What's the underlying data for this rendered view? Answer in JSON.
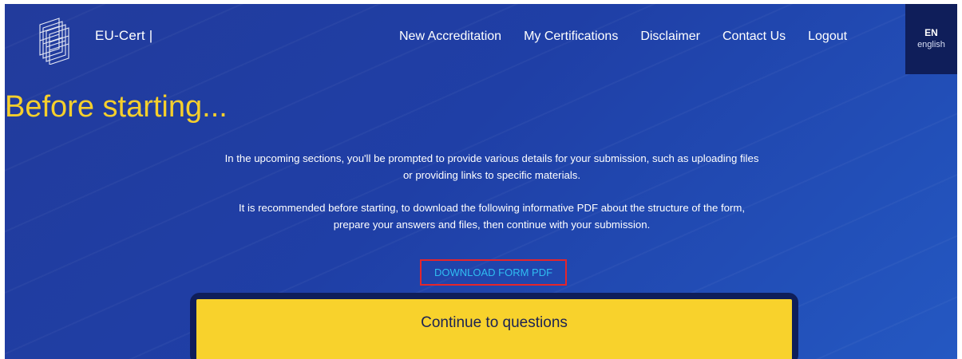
{
  "header": {
    "brand": "EU-Cert |",
    "logo_icon": "eu-cert-logo-icon",
    "nav": [
      {
        "label": "New Accreditation"
      },
      {
        "label": "My Certifications"
      },
      {
        "label": "Disclaimer"
      },
      {
        "label": "Contact Us"
      },
      {
        "label": "Logout"
      }
    ],
    "language": {
      "code": "EN",
      "name": "english"
    }
  },
  "main": {
    "title": "Before starting...",
    "intro_1_line_1": "In the upcoming sections, you'll be prompted to provide various details for your submission, such as uploading files",
    "intro_1_line_2": "or providing links to specific materials.",
    "intro_2_line_1": "It is recommended before starting, to download the following informative PDF about the structure of the form,",
    "intro_2_line_2": "prepare your answers and files, then continue with your submission.",
    "download_label": "DOWNLOAD FORM PDF",
    "continue_label": "Continue to questions"
  },
  "colors": {
    "background": "#1f3fa6",
    "accent_yellow": "#f8d22c",
    "title_yellow": "#f6cf2c",
    "link_cyan": "#2fbdf1",
    "highlight_red": "#e5252b",
    "dark_navy": "#0f1e5a"
  }
}
